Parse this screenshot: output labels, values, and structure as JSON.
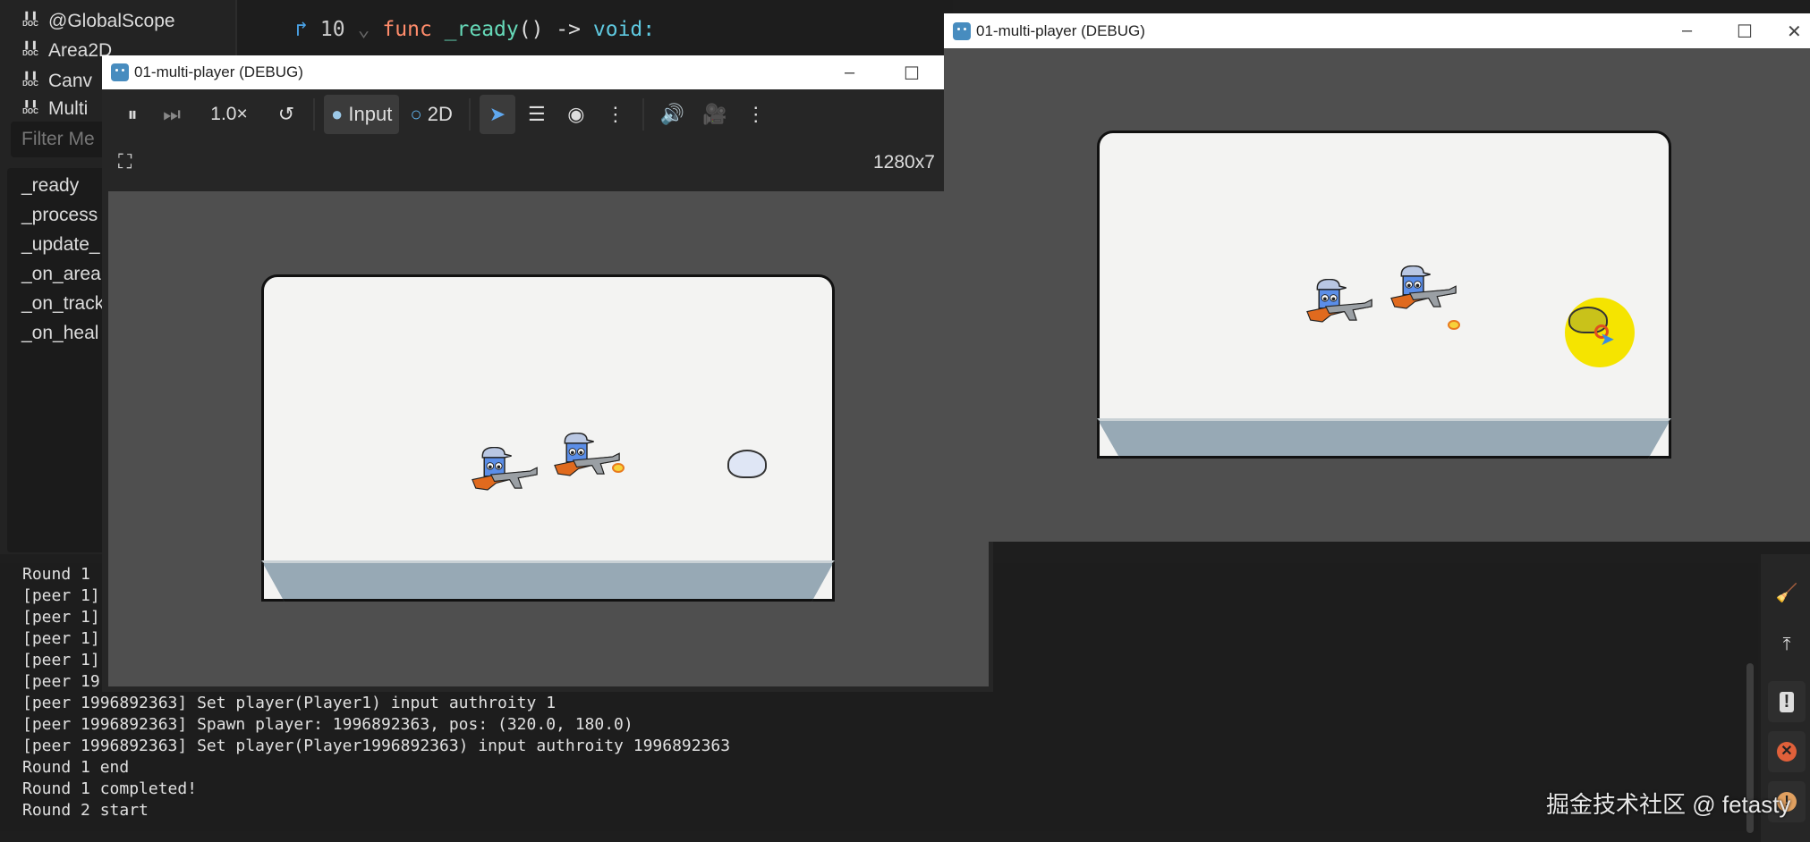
{
  "sidebar": {
    "docs": [
      "@GlobalScope",
      "Area2D",
      "Canv",
      "Multi"
    ],
    "filter_placeholder": "Filter Me",
    "methods": [
      "_ready",
      "_process",
      "_update_",
      "_on_area",
      "_on_track",
      "_on_heal"
    ]
  },
  "code": {
    "line_number": "10",
    "keyword": "func",
    "name": "_ready",
    "rest": "() ->",
    "type": "void:"
  },
  "window1": {
    "title": "01-multi-player (DEBUG)",
    "speed": "1.0×",
    "input_label": "Input",
    "mode_label": "2D",
    "resolution": "1280x7"
  },
  "window2": {
    "title": "01-multi-player (DEBUG)"
  },
  "console": {
    "lines": [
      "Round 1",
      "[peer 1]",
      "[peer 1]",
      "[peer 1]",
      "[peer 1]",
      "[peer 19",
      "[peer 1996892363] Set player(Player1) input authroity 1",
      "[peer 1996892363] Spawn player: 1996892363, pos: (320.0, 180.0)",
      "[peer 1996892363] Set player(Player1996892363) input authroity 1996892363",
      "Round 1 end",
      "Round 1 completed!",
      "Round 2 start"
    ]
  },
  "watermark": "掘金技术社区 @ fetasty",
  "colors": {
    "accent": "#478cbf",
    "error": "#e0603a",
    "warning": "#e0a060",
    "highlight": "#f5e400"
  }
}
